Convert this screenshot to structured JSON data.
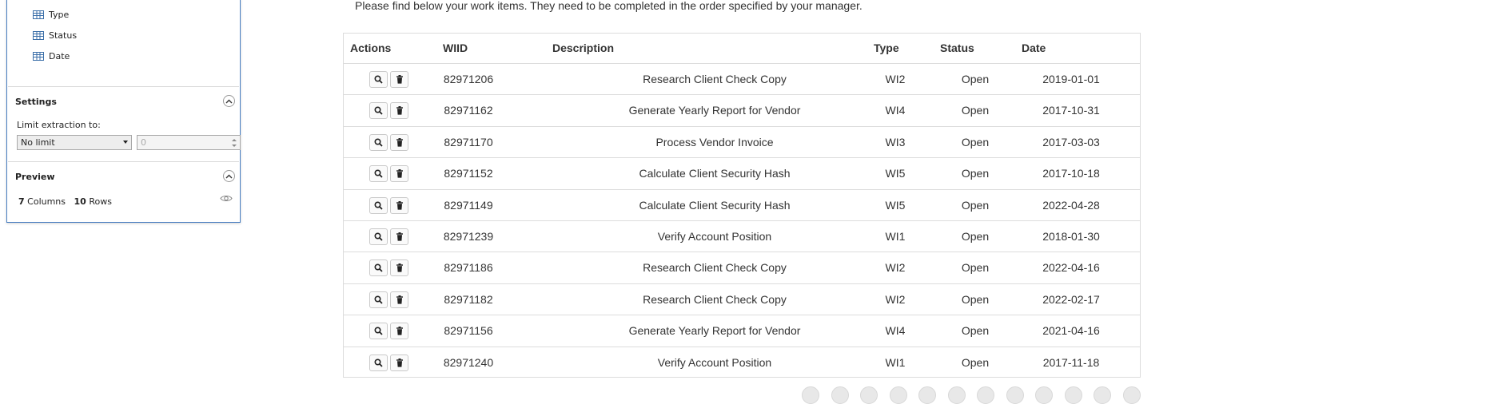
{
  "panel": {
    "fields": [
      {
        "label": "Type",
        "icon": "table-column-icon"
      },
      {
        "label": "Status",
        "icon": "table-column-icon"
      },
      {
        "label": "Date",
        "icon": "table-column-icon"
      }
    ],
    "settings": {
      "title": "Settings",
      "limit_label": "Limit extraction to:",
      "limit_value": "No limit",
      "limit_count_placeholder": "0"
    },
    "preview": {
      "title": "Preview",
      "columns_count": "7",
      "columns_word": "Columns",
      "rows_count": "10",
      "rows_word": "Rows"
    }
  },
  "main": {
    "intro": "Please find below your work items. They need to be completed in the order specified by your manager.",
    "headers": {
      "actions": "Actions",
      "wiid": "WIID",
      "description": "Description",
      "type": "Type",
      "status": "Status",
      "date": "Date"
    },
    "rows": [
      {
        "wiid": "82971206",
        "description": "Research Client Check Copy",
        "type": "WI2",
        "status": "Open",
        "date": "2019-01-01"
      },
      {
        "wiid": "82971162",
        "description": "Generate Yearly Report for Vendor",
        "type": "WI4",
        "status": "Open",
        "date": "2017-10-31"
      },
      {
        "wiid": "82971170",
        "description": "Process Vendor Invoice",
        "type": "WI3",
        "status": "Open",
        "date": "2017-03-03"
      },
      {
        "wiid": "82971152",
        "description": "Calculate Client Security Hash",
        "type": "WI5",
        "status": "Open",
        "date": "2017-10-18"
      },
      {
        "wiid": "82971149",
        "description": "Calculate Client Security Hash",
        "type": "WI5",
        "status": "Open",
        "date": "2022-04-28"
      },
      {
        "wiid": "82971239",
        "description": "Verify Account Position",
        "type": "WI1",
        "status": "Open",
        "date": "2018-01-30"
      },
      {
        "wiid": "82971186",
        "description": "Research Client Check Copy",
        "type": "WI2",
        "status": "Open",
        "date": "2022-04-16"
      },
      {
        "wiid": "82971182",
        "description": "Research Client Check Copy",
        "type": "WI2",
        "status": "Open",
        "date": "2022-02-17"
      },
      {
        "wiid": "82971156",
        "description": "Generate Yearly Report for Vendor",
        "type": "WI4",
        "status": "Open",
        "date": "2021-04-16"
      },
      {
        "wiid": "82971240",
        "description": "Verify Account Position",
        "type": "WI1",
        "status": "Open",
        "date": "2017-11-18"
      }
    ]
  },
  "pager": {
    "buttons": [
      "",
      "",
      "",
      "",
      "",
      "",
      "",
      "",
      "",
      "",
      "",
      ""
    ]
  },
  "colors": {
    "panel_border": "#4a7fc1",
    "table_border": "#dcdcdc",
    "text": "#333333"
  }
}
